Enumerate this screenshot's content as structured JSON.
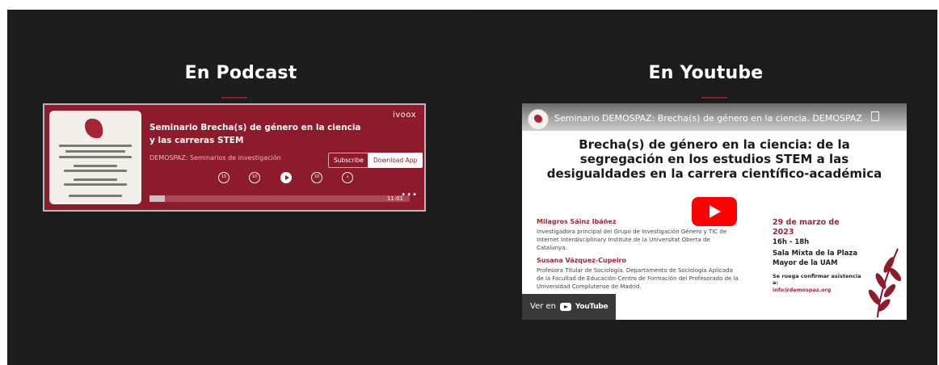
{
  "podcast_section": {
    "heading": "En Podcast",
    "player": {
      "brand": "ivoox",
      "episode_title": "Seminario Brecha(s) de género en la ciencia y las carreras STEM",
      "channel": "DEMOSPAZ: Seminarios de investigación",
      "subscribe_label": "Subscribe",
      "download_label": "Download App",
      "controls": [
        "rewind-icon",
        "back-icon",
        "play-icon",
        "forward-icon",
        "download-icon"
      ],
      "time": "11:01",
      "progress": 0.06
    }
  },
  "youtube_section": {
    "heading": "En Youtube",
    "video": {
      "title": "Seminario DEMOSPAZ: Brecha(s) de género en la ciencia. DEMOSPAZ",
      "headline": "Brecha(s) de género en la ciencia: de la segregación en los estudios STEM a las desigualdades en la carrera científico-académica",
      "speaker1_name": "Milagros Sáinz Ibáñez",
      "speaker1_desc": "Investigadora principal del Grupo de Investigación Género y TIC de Internet Interdisciplinary Institute de la Universitat Oberta de Catalunya.",
      "speaker2_name": "Susana Vázquez-Cupeiro",
      "speaker2_desc": "Profesora Titular de Sociología. Departamento de Sociología Aplicada de la Facultad de Educación-Centro de Formación del Profesorado de la Universidad Complutense de Madrid.",
      "date": "29 de marzo de 2023",
      "time": "16h - 18h",
      "place": "Sala Mixta de la Plaza Mayor de la UAM",
      "rsvp": "Se ruega confirmar asistencia a:",
      "email": "info@demospaz.org",
      "watch_on": "Ver en",
      "watch_brand": "YouTube"
    }
  },
  "colors": {
    "panel_bg": "#1e1d1d",
    "accent": "#8a1f2a",
    "player_bg": "#8e1b2c",
    "youtube_red": "#ff0000"
  }
}
